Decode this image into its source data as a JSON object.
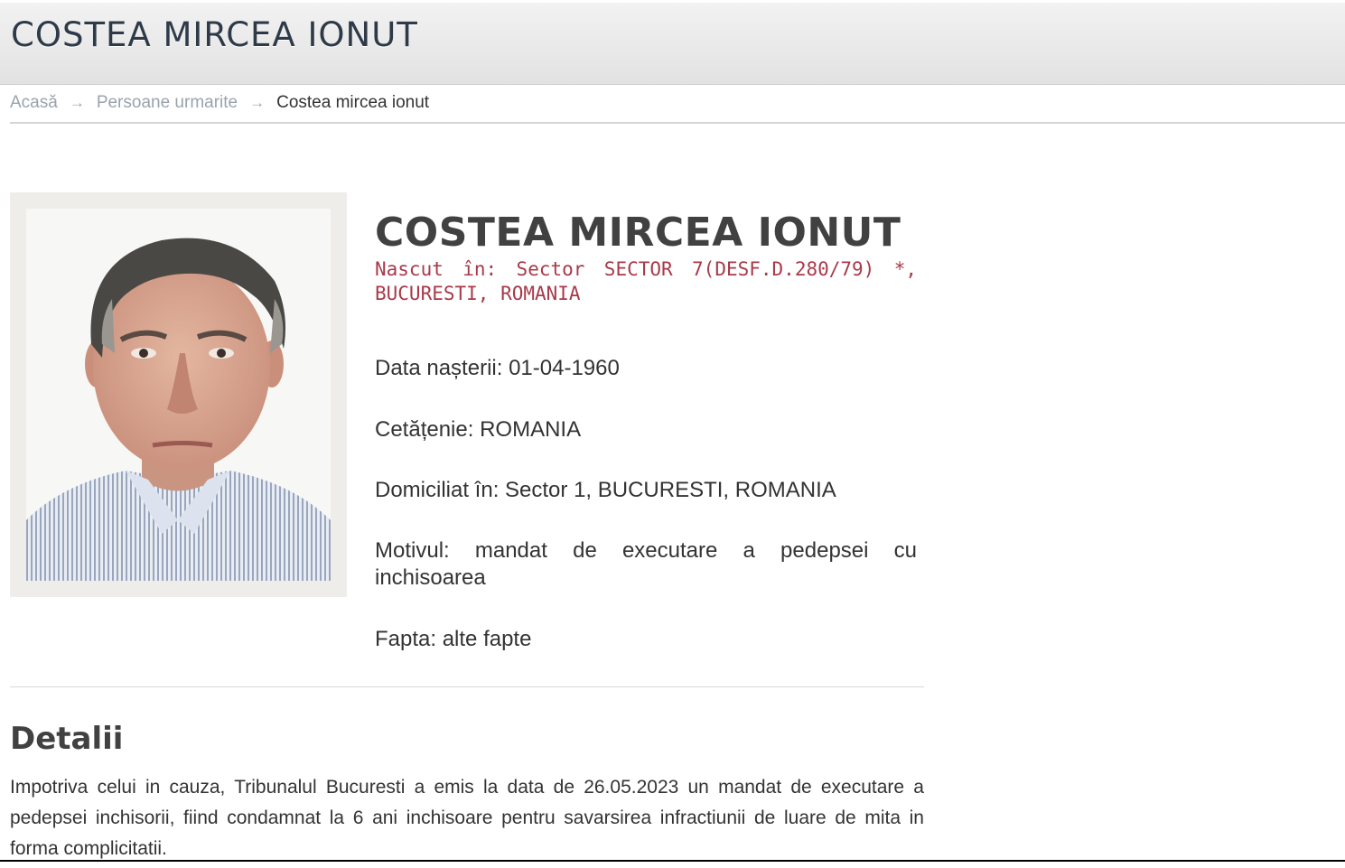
{
  "page": {
    "title": "COSTEA MIRCEA IONUT"
  },
  "breadcrumb": {
    "items": [
      {
        "label": "Acasă"
      },
      {
        "label": "Persoane urmarite"
      }
    ],
    "separator": "→",
    "current": "Costea mircea ionut"
  },
  "photo": {
    "icon": "person-photo"
  },
  "person": {
    "name": "COSTEA MIRCEA IONUT",
    "born": "Nascut în: Sector SECTOR 7(DESF.D.280/79) *, BUCURESTI, ROMANIA",
    "birth_date": "Data nașterii: 01-04-1960",
    "citizenship": "Cetățenie: ROMANIA",
    "domicile": "Domiciliat în: Sector 1, BUCURESTI, ROMANIA",
    "reason": "Motivul: mandat de executare a pedepsei cu inchisoarea",
    "deed": "Fapta: alte fapte"
  },
  "details": {
    "title": "Detalii",
    "text": "Impotriva celui in cauza, Tribunalul Bucuresti a emis la data de 26.05.2023 un mandat de executare a pedepsei inchisorii, fiind condamnat la 6 ani inchisoare pentru savarsirea infractiunii de luare de mita in forma complicitatii."
  },
  "colors": {
    "title": "#2e3a48",
    "born": "#a83a4a",
    "breadcrumb_link": "#9aa3ad"
  }
}
